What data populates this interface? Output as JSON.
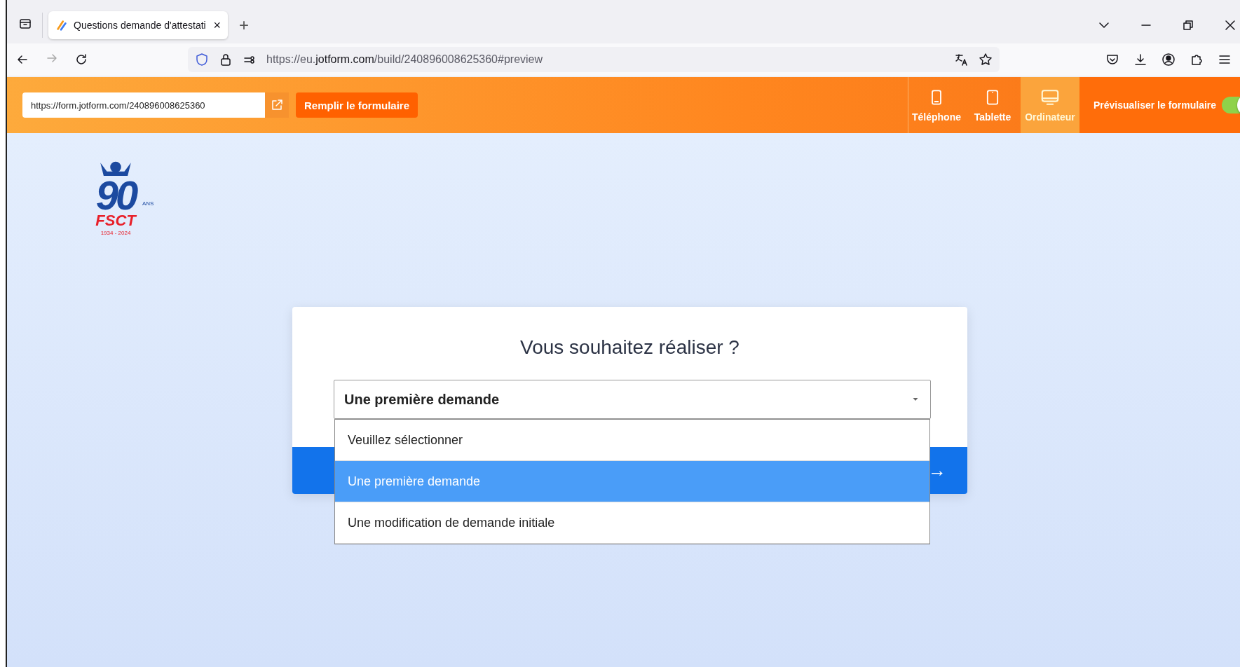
{
  "browser": {
    "tab_title": "Questions demande d'attestati",
    "tab_close": "×",
    "new_tab": "+",
    "url_prefix": "https://eu.",
    "url_domain": "jotform.com",
    "url_path": "/build/240896008625360#preview"
  },
  "toolbar": {
    "form_url": "https://form.jotform.com/240896008625360",
    "fill_button": "Remplir le formulaire",
    "devices": [
      {
        "label": "Téléphone",
        "kind": "phone",
        "selected": false
      },
      {
        "label": "Tablette",
        "kind": "tablet",
        "selected": false
      },
      {
        "label": "Ordinateur",
        "kind": "desktop",
        "selected": true
      }
    ],
    "preview_label": "Prévisualiser le formulaire",
    "preview_on": true
  },
  "logo": {
    "number": "90",
    "ans": "ANS",
    "name": "FSCT",
    "years": "1934 - 2024"
  },
  "question": {
    "title": "Vous souhaitez réaliser ?",
    "value": "Une première demande",
    "expanded": true,
    "options": [
      {
        "label": "Veuillez sélectionner",
        "selected": false
      },
      {
        "label": "Une première demande",
        "selected": true
      },
      {
        "label": "Une modification de demande initiale",
        "selected": false
      }
    ]
  },
  "next_arrow": "→"
}
